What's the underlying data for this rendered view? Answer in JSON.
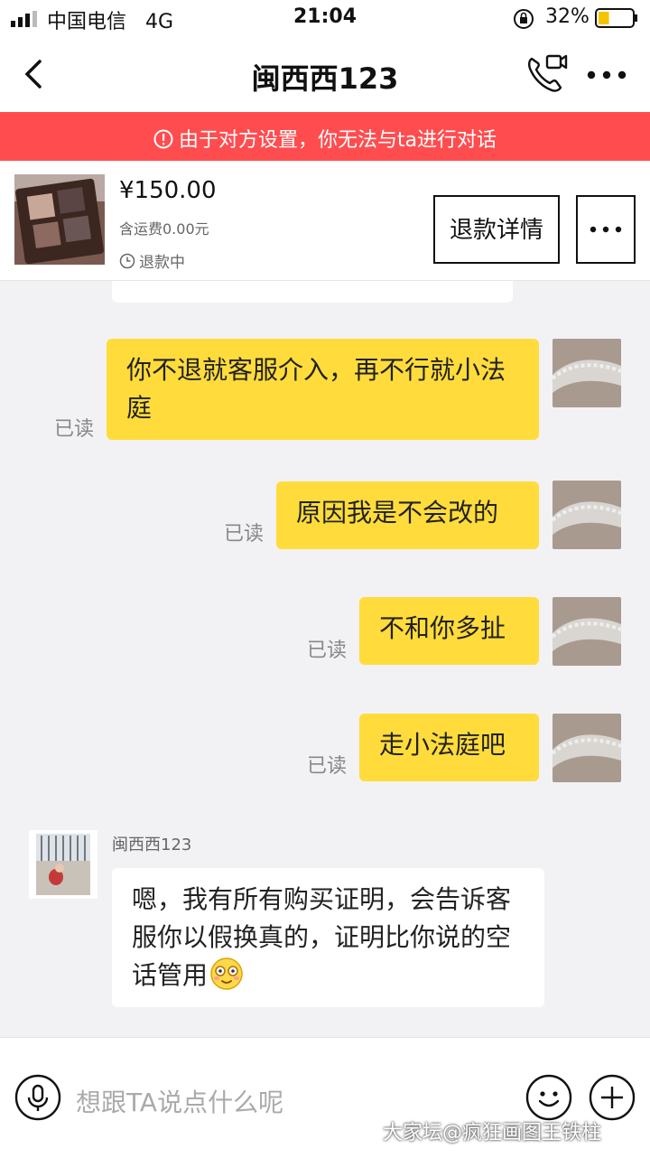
{
  "status": {
    "carrier": "中国电信",
    "network": "4G",
    "time": "21:04",
    "battery_pct": "32%",
    "battery_level": 0.32
  },
  "nav": {
    "title": "闽西西123",
    "back_icon": "chevron-left-icon",
    "call_icon": "video-call-icon",
    "more_icon": "more-dots-icon"
  },
  "banner": {
    "text": "由于对方设置，你无法与ta进行对话",
    "color": "#ff4d4f"
  },
  "product": {
    "price": "¥150.00",
    "shipping": "含运费0.00元",
    "status": "退款中",
    "refund_button": "退款详情"
  },
  "messages": [
    {
      "from": "me",
      "text": "你不退就客服介入，再不行就小法庭",
      "read": "已读"
    },
    {
      "from": "me",
      "text": "原因我是不会改的",
      "read": "已读"
    },
    {
      "from": "me",
      "text": "不和你多扯",
      "read": "已读"
    },
    {
      "from": "me",
      "text": "走小法庭吧",
      "read": "已读"
    },
    {
      "from": "them",
      "sender": "闽西西123",
      "text": "嗯，我有所有购买证明，会告诉客服你以假换真的，证明比你说的空话管用"
    }
  ],
  "input": {
    "placeholder": "想跟TA说点什么呢"
  },
  "watermark": "大家坛@疯狂画图王铁柱",
  "colors": {
    "my_bubble": "#ffdc3c",
    "their_bubble": "#ffffff",
    "background": "#f2f2f4",
    "accent_red": "#ff4d4f"
  }
}
